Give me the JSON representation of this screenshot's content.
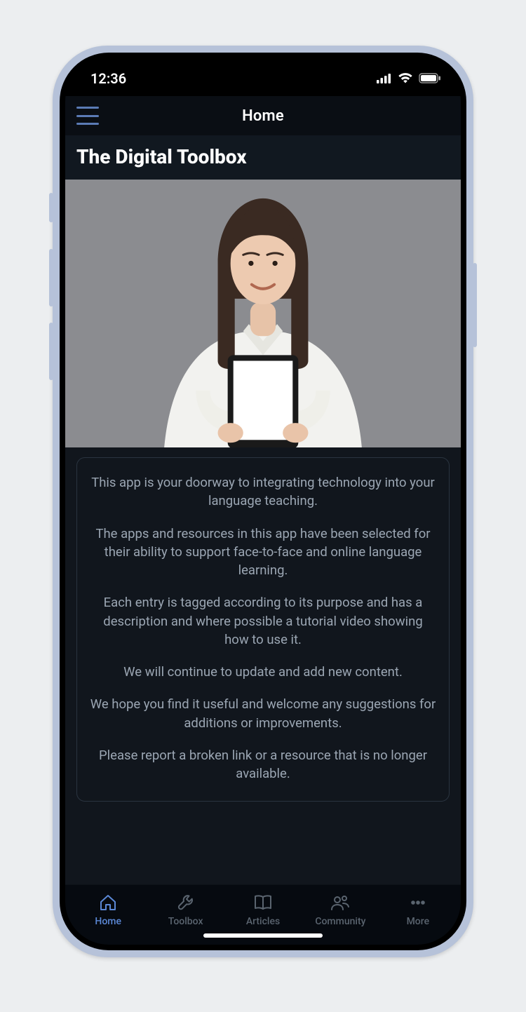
{
  "status": {
    "time": "12:36"
  },
  "nav": {
    "title": "Home"
  },
  "page": {
    "title": "The Digital Toolbox"
  },
  "info": {
    "p1": "This app is your doorway to integrating technology into your language teaching.",
    "p2": "The apps and resources in this app have been selected for their ability to support face-to-face and online language learning.",
    "p3": "Each entry is tagged according to its purpose and has a description and where possible a tutorial video showing how to use it.",
    "p4": "We will continue to update and add new content.",
    "p5": "We hope you find it useful and welcome any suggestions for additions or improvements.",
    "p6": "Please report a broken link or a resource that is no longer available."
  },
  "tabs": {
    "home": "Home",
    "toolbox": "Toolbox",
    "articles": "Articles",
    "community": "Community",
    "more": "More"
  },
  "colors": {
    "accent": "#5b88d6",
    "text_muted": "#9ba6b3",
    "bg_dark": "#11161d"
  }
}
